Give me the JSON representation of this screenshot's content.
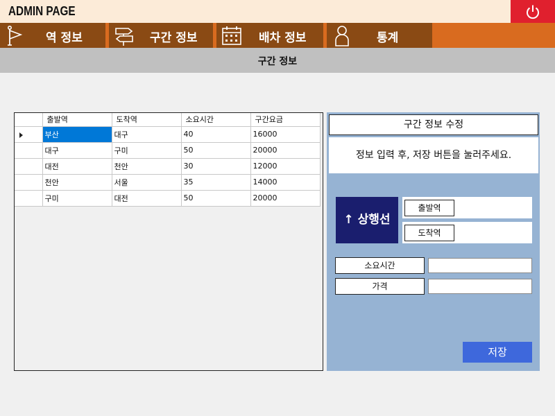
{
  "app": {
    "title": "ADMIN PAGE"
  },
  "nav": {
    "items": [
      {
        "label": "역 정보",
        "icon": "flag-icon"
      },
      {
        "label": "구간 정보",
        "icon": "signpost-icon"
      },
      {
        "label": "배차 정보",
        "icon": "calendar-icon"
      },
      {
        "label": "통계",
        "icon": "person-icon"
      }
    ]
  },
  "page": {
    "header": "구간 정보"
  },
  "grid": {
    "columns": [
      "출발역",
      "도착역",
      "소요시간",
      "구간요금"
    ],
    "rows": [
      [
        "부산",
        "대구",
        "40",
        "16000"
      ],
      [
        "대구",
        "구미",
        "50",
        "20000"
      ],
      [
        "대전",
        "천안",
        "30",
        "12000"
      ],
      [
        "천안",
        "서울",
        "35",
        "14000"
      ],
      [
        "구미",
        "대전",
        "50",
        "20000"
      ]
    ],
    "selected_row": 0
  },
  "panel": {
    "title": "구간 정보 수정",
    "message": "정보 입력 후, 저장 버튼을 눌러주세요.",
    "direction_label": "↑ 상행선",
    "departure_label": "출발역",
    "arrival_label": "도착역",
    "duration_label": "소요시간",
    "duration_value": "",
    "price_label": "가격",
    "price_value": "",
    "save_label": "저장"
  },
  "colors": {
    "titlebar": "#fcebd8",
    "power": "#e0202e",
    "nav_bar": "#d96b1f",
    "nav_item": "#8a4a14",
    "selection": "#0078d7",
    "panel": "#96b3d3",
    "direction": "#1a1e6e",
    "save": "#3e68dc"
  }
}
